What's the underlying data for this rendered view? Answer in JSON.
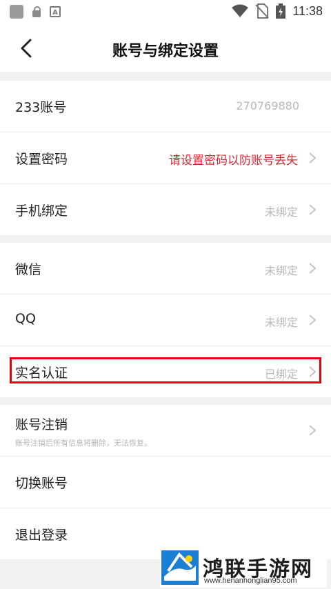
{
  "status_bar": {
    "time": "11:38",
    "a_badge": "A"
  },
  "header": {
    "title": "账号与绑定设置"
  },
  "group1": {
    "items": [
      {
        "label": "233账号",
        "value": "270769880"
      },
      {
        "label": "设置密码",
        "value": "请设置密码以防账号丢失"
      },
      {
        "label": "手机绑定",
        "value": "未绑定"
      }
    ]
  },
  "group2": {
    "items": [
      {
        "label": "微信",
        "value": "未绑定"
      },
      {
        "label": "QQ",
        "value": "未绑定"
      },
      {
        "label": "实名认证",
        "value": "已绑定"
      }
    ]
  },
  "group3": {
    "items": [
      {
        "label": "账号注销",
        "sublabel": "账号注销后所有信息将删除，无法恢复。"
      },
      {
        "label": "切换账号"
      },
      {
        "label": "退出登录"
      }
    ]
  },
  "watermark": {
    "name": "鸿联手游网",
    "url": "www.henanhonglian95.com"
  },
  "colors": {
    "warning": "#d8262f",
    "highlight": "#e00012",
    "page_bg": "#f2f2f2"
  }
}
